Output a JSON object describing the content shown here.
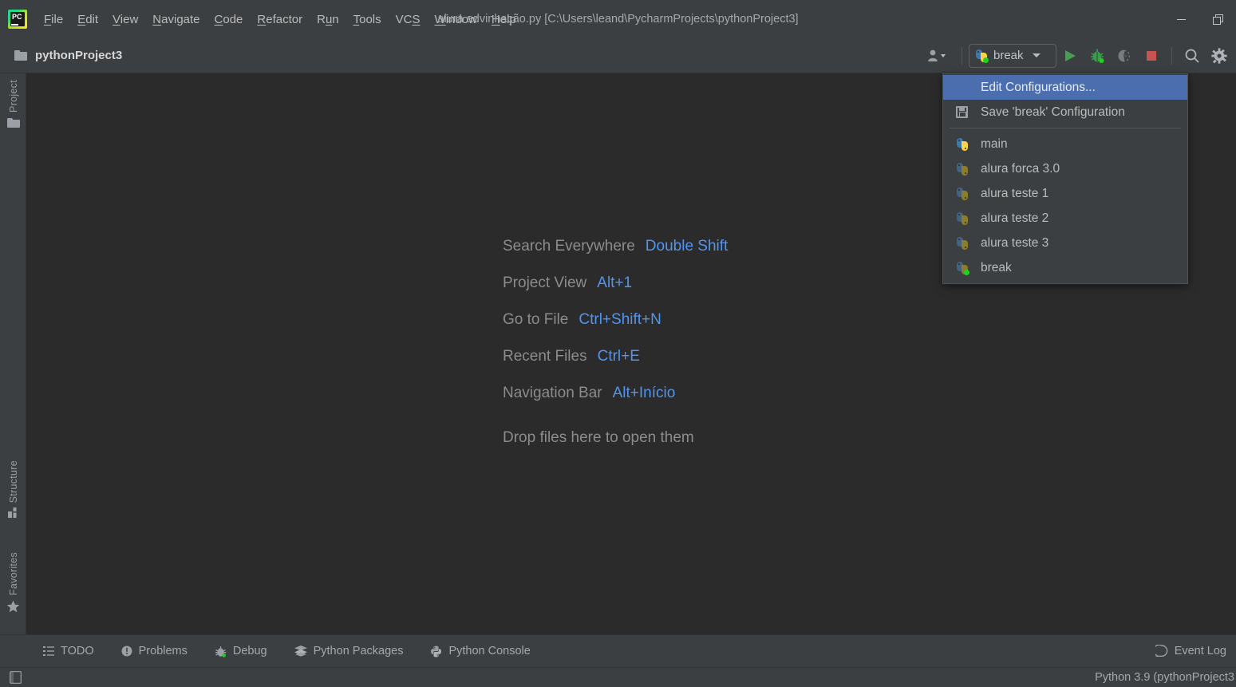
{
  "window": {
    "title": "alura advinhação.py [C:\\Users\\leand\\PycharmProjects\\pythonProject3]",
    "app_icon": "pycharm-logo-icon",
    "logo_text": "PC",
    "controls": {
      "minimize": "minimize-icon",
      "restore": "restore-icon"
    }
  },
  "menubar": {
    "items": [
      {
        "label": "File",
        "mnemonic": "F"
      },
      {
        "label": "Edit",
        "mnemonic": "E"
      },
      {
        "label": "View",
        "mnemonic": "V"
      },
      {
        "label": "Navigate",
        "mnemonic": "N"
      },
      {
        "label": "Code",
        "mnemonic": "C"
      },
      {
        "label": "Refactor",
        "mnemonic": "R"
      },
      {
        "label": "Run",
        "mnemonic": "u"
      },
      {
        "label": "Tools",
        "mnemonic": "T"
      },
      {
        "label": "VCS",
        "mnemonic": "S"
      },
      {
        "label": "Window",
        "mnemonic": "W"
      },
      {
        "label": "Help",
        "mnemonic": "H"
      }
    ]
  },
  "toolbar": {
    "project_name": "pythonProject3",
    "folder_icon": "folder-icon",
    "account_icon": "user-account-icon",
    "run_config": {
      "label": "break",
      "icon": "python-config-icon",
      "has_green_dot": true,
      "dropdown_icon": "chevron-down-icon"
    },
    "actions": [
      {
        "name": "run-button",
        "icon": "play-triangle-icon",
        "color": "#59a869"
      },
      {
        "name": "debug-button",
        "icon": "bug-icon",
        "color": "#3cb371"
      },
      {
        "name": "run-coverage-button",
        "icon": "coverage-icon",
        "color": "#6e7072"
      },
      {
        "name": "stop-button",
        "icon": "stop-square-icon",
        "color": "#c75450"
      },
      {
        "name": "search-button",
        "icon": "search-icon",
        "color": "#9aa0a6"
      },
      {
        "name": "settings-button",
        "icon": "gear-icon",
        "color": "#9aa0a6"
      }
    ]
  },
  "run_config_menu": {
    "edit_configurations": "Edit Configurations...",
    "save_configuration": "Save 'break' Configuration",
    "save_icon": "floppy-disk-icon",
    "configurations": [
      {
        "label": "main",
        "icon": "python-icon",
        "dimmed": false,
        "running": false
      },
      {
        "label": "alura forca 3.0",
        "icon": "python-icon",
        "dimmed": true,
        "running": false
      },
      {
        "label": "alura teste 1",
        "icon": "python-icon",
        "dimmed": true,
        "running": false
      },
      {
        "label": "alura teste 2",
        "icon": "python-icon",
        "dimmed": true,
        "running": false
      },
      {
        "label": "alura teste 3",
        "icon": "python-icon",
        "dimmed": true,
        "running": false
      },
      {
        "label": "break",
        "icon": "python-icon",
        "dimmed": true,
        "running": true
      }
    ],
    "highlight_color": "#4b6eaf"
  },
  "left_tool_strip": {
    "items": [
      {
        "label": "Project",
        "icon": "folder-icon"
      },
      {
        "label": "Structure",
        "icon": "structure-icon"
      },
      {
        "label": "Favorites",
        "icon": "star-icon"
      }
    ]
  },
  "editor": {
    "hints": [
      {
        "label": "Search Everywhere",
        "shortcut": "Double Shift"
      },
      {
        "label": "Project View",
        "shortcut": "Alt+1"
      },
      {
        "label": "Go to File",
        "shortcut": "Ctrl+Shift+N"
      },
      {
        "label": "Recent Files",
        "shortcut": "Ctrl+E"
      },
      {
        "label": "Navigation Bar",
        "shortcut": "Alt+Início"
      }
    ],
    "drop_hint": "Drop files here to open them",
    "background_color": "#2b2b2b",
    "shortcut_color": "#5394ec"
  },
  "bottom_bar": {
    "items": [
      {
        "label": "TODO",
        "icon": "todo-list-icon"
      },
      {
        "label": "Problems",
        "icon": "problems-icon"
      },
      {
        "label": "Debug",
        "icon": "bug-icon"
      },
      {
        "label": "Python Packages",
        "icon": "layers-icon"
      },
      {
        "label": "Python Console",
        "icon": "python-icon"
      }
    ],
    "event_log": {
      "label": "Event Log",
      "icon": "event-log-icon"
    }
  },
  "status_bar": {
    "left_icon": "hide-tool-windows-icon",
    "interpreter": "Python 3.9 (pythonProject3"
  }
}
